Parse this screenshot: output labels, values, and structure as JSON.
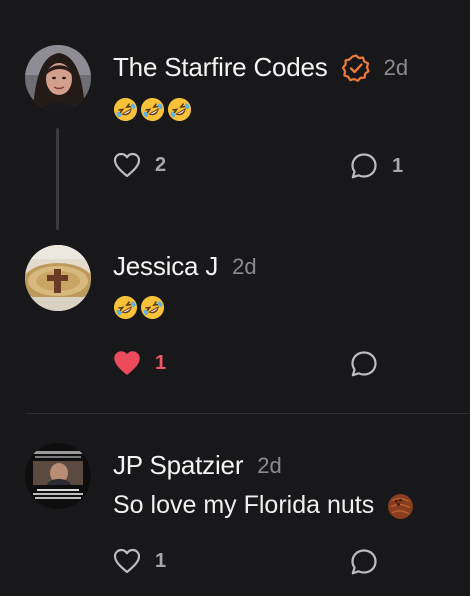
{
  "replies": [
    {
      "author": "The Starfire Codes",
      "verified": true,
      "time": "2d",
      "text": "",
      "likes": "2",
      "replies": "1",
      "liked": false
    },
    {
      "author": "Jessica J",
      "verified": false,
      "time": "2d",
      "text": "",
      "likes": "1",
      "replies": "",
      "liked": true
    },
    {
      "author": "JP Spatzier",
      "verified": false,
      "time": "2d",
      "text": "So love my Florida nuts",
      "likes": "1",
      "replies": "",
      "liked": false
    }
  ],
  "colors": {
    "background": "#18181a",
    "verified_badge": "#ee7a3a",
    "liked_heart": "#ec4b5c",
    "muted": "#8c8c8f"
  },
  "icons": {
    "like": "heart-outline-icon",
    "liked": "heart-filled-icon",
    "reply": "speech-bubble-icon",
    "verified": "verified-badge-icon",
    "laughing": "rolling-on-floor-laughing-emoji",
    "nut": "coconut-emoji"
  }
}
